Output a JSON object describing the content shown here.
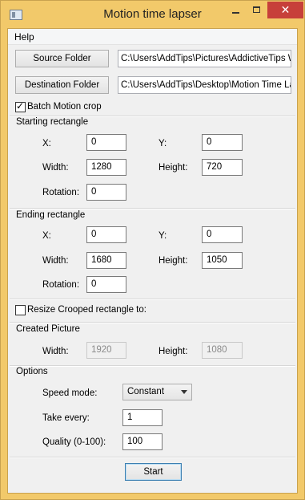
{
  "window": {
    "title": "Motion time lapser",
    "min_symbol": "",
    "max_symbol": "",
    "close_symbol": "✕"
  },
  "menu": {
    "help": "Help"
  },
  "source": {
    "button": "Source Folder",
    "path": "C:\\Users\\AddTips\\Pictures\\AddictiveTips Wa"
  },
  "destination": {
    "button": "Destination Folder",
    "path": "C:\\Users\\AddTips\\Desktop\\Motion Time Laps"
  },
  "batch": {
    "label": "Batch Motion crop",
    "checked": true
  },
  "starting": {
    "title": "Starting rectangle",
    "x_label": "X:",
    "x": "0",
    "y_label": "Y:",
    "y": "0",
    "width_label": "Width:",
    "width": "1280",
    "height_label": "Height:",
    "height": "720",
    "rotation_label": "Rotation:",
    "rotation": "0"
  },
  "ending": {
    "title": "Ending rectangle",
    "x_label": "X:",
    "x": "0",
    "y_label": "Y:",
    "y": "0",
    "width_label": "Width:",
    "width": "1680",
    "height_label": "Height:",
    "height": "1050",
    "rotation_label": "Rotation:",
    "rotation": "0"
  },
  "resize": {
    "label": "Resize Crooped rectangle to:",
    "checked": false
  },
  "created": {
    "title": "Created Picture",
    "width_label": "Width:",
    "width": "1920",
    "height_label": "Height:",
    "height": "1080"
  },
  "options": {
    "title": "Options",
    "speed_label": "Speed mode:",
    "speed_value": "Constant",
    "take_label": "Take every:",
    "take_value": "1",
    "quality_label": "Quality (0-100):",
    "quality_value": "100"
  },
  "start_button": "Start",
  "colors": {
    "titlebar": "#f2c96a",
    "close": "#c7403a",
    "client": "#f0f0f0"
  }
}
